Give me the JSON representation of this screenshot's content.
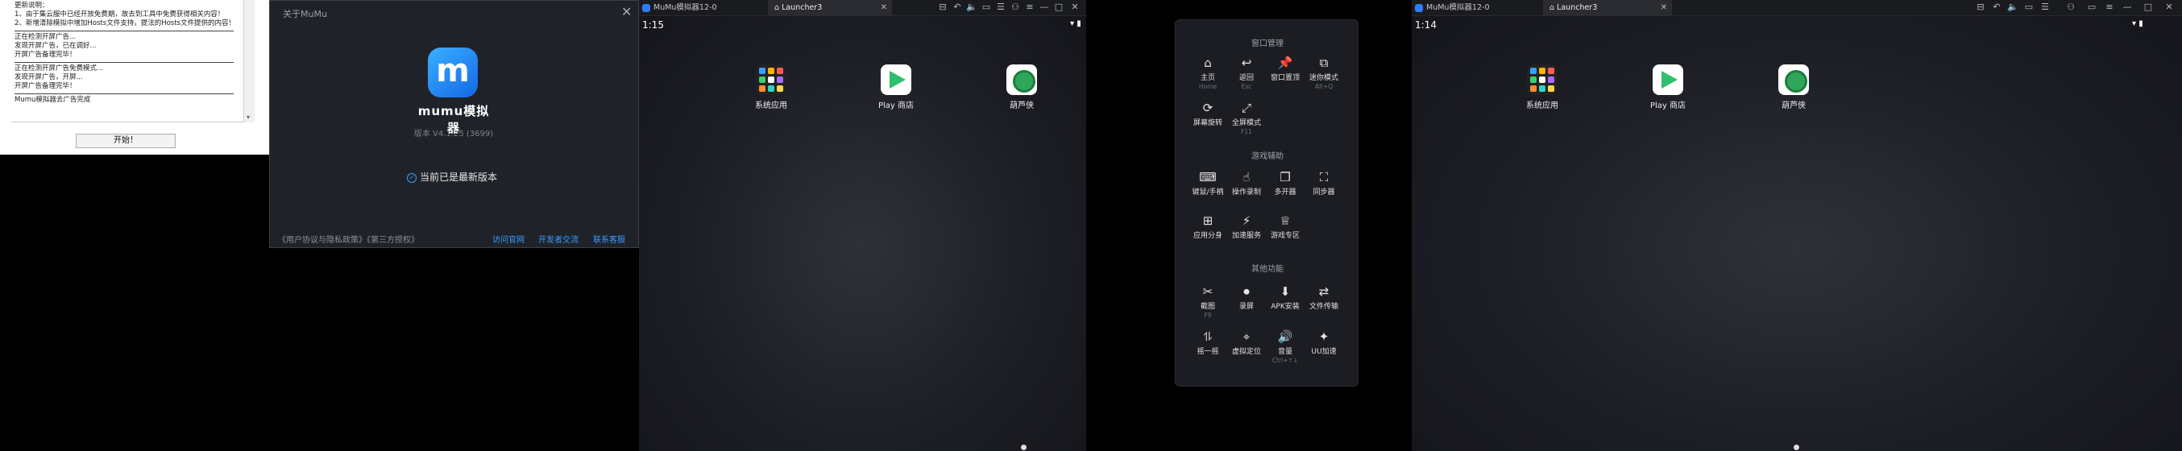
{
  "tool": {
    "log_lines": [
      "更新说明：",
      "1、由于集云服中已经开放免费期，故去到工具中免费获得相关内容！",
      "2、新增清除模拟中增加Hosts文件支持，提法的Hosts文件提供的内容！"
    ],
    "log_block2": [
      "正在检测开屏广告...",
      "发现开屏广告，已在调好...",
      "开屏广告备理完毕！"
    ],
    "log_block3": [
      "正在检测开屏广告免费模式...",
      "发现开屏广告，开屏...",
      "开屏广告备理完毕！"
    ],
    "log_final": "Mumu模拟器去广告完成",
    "scroll_arrow": "▾",
    "start_button": "开始！"
  },
  "about": {
    "title": "关于MuMu",
    "close": "✕",
    "logo_glyph": "m",
    "brand": "mumu模拟器",
    "version": "版本 V4.1.25 (3699)",
    "check_icon": "✓",
    "status": "当前已是最新版本",
    "footer_links": "《用户协议与隐私政策》《第三方授权》",
    "link_official": "访问官网",
    "link_community": "开发者交流",
    "link_contact": "联系客服"
  },
  "emu1": {
    "tab_home": "MuMu模拟器12-0",
    "tab_launcher": "Launcher3",
    "tab_close": "✕",
    "time": "1:15",
    "status": "▾ ▮",
    "apps": [
      "系统应用",
      "Play 商店",
      "葫芦侠"
    ]
  },
  "emu2": {
    "tab_home": "MuMu模拟器12-0",
    "tab_launcher": "Launcher3",
    "tab_close": "✕",
    "time": "1:14",
    "status": "▾ ▮",
    "apps": [
      "系统应用",
      "Play 商店",
      "葫芦侠"
    ]
  },
  "controls": [
    "⊟",
    "↶",
    "🔈",
    "▭",
    "☰",
    "⚇",
    "≡",
    "▭",
    "—",
    "□",
    "✕"
  ],
  "panel": {
    "sec1": "窗口管理",
    "sec2": "游戏辅助",
    "sec3": "其他功能",
    "items1": [
      {
        "g": "⌂",
        "l": "主页",
        "k": "Home"
      },
      {
        "g": "↩",
        "l": "返回",
        "k": "Esc"
      },
      {
        "g": "📌",
        "l": "窗口置顶",
        "k": ""
      },
      {
        "g": "⧉",
        "l": "迷你模式",
        "k": "Alt+Q"
      },
      {
        "g": "⟳",
        "l": "屏幕旋转",
        "k": ""
      },
      {
        "g": "⤢",
        "l": "全屏模式",
        "k": "F11"
      }
    ],
    "items2": [
      {
        "g": "⌨",
        "l": "键鼠/手柄",
        "k": ""
      },
      {
        "g": "☝",
        "l": "操作录制",
        "k": ""
      },
      {
        "g": "❐",
        "l": "多开器",
        "k": ""
      },
      {
        "g": "⛶",
        "l": "同步器",
        "k": ""
      },
      {
        "g": "⊞",
        "l": "应用分身",
        "k": ""
      },
      {
        "g": "⚡",
        "l": "加速服务",
        "k": ""
      },
      {
        "g": "♕",
        "l": "游戏专区",
        "k": ""
      }
    ],
    "items3": [
      {
        "g": "✂",
        "l": "截图",
        "k": "F9"
      },
      {
        "g": "⏺",
        "l": "录屏",
        "k": ""
      },
      {
        "g": "⬇",
        "l": "APK安装",
        "k": ""
      },
      {
        "g": "⇄",
        "l": "文件传输",
        "k": ""
      },
      {
        "g": "⥮",
        "l": "摇一摇",
        "k": ""
      },
      {
        "g": "⌖",
        "l": "虚拟定位",
        "k": ""
      },
      {
        "g": "🔊",
        "l": "音量",
        "k": "Ctrl+↑↓"
      },
      {
        "g": "✦",
        "l": "UU加速",
        "k": ""
      }
    ]
  }
}
